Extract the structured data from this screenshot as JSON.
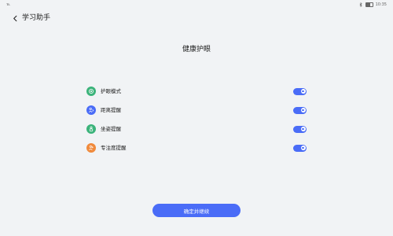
{
  "status_bar": {
    "left_text": "℡",
    "time": "10:35",
    "icons": [
      "bluetooth-icon",
      "battery-icon"
    ]
  },
  "header": {
    "back_icon": "chevron-left-icon",
    "title": "学习助手"
  },
  "page_title": "健康护眼",
  "settings": [
    {
      "label": "护眼模式",
      "icon": "eye-icon",
      "icon_color": "#3bb37a",
      "enabled": true
    },
    {
      "label": "距离提醒",
      "icon": "distance-icon",
      "icon_color": "#4a6cf7",
      "enabled": true
    },
    {
      "label": "坐姿提醒",
      "icon": "posture-icon",
      "icon_color": "#3bb37a",
      "enabled": true
    },
    {
      "label": "专注度提醒",
      "icon": "focus-icon",
      "icon_color": "#f08a3c",
      "enabled": true
    }
  ],
  "confirm_button": {
    "label": "确定并继续"
  },
  "colors": {
    "accent": "#4a6cf7",
    "background": "#f1f3f5"
  }
}
